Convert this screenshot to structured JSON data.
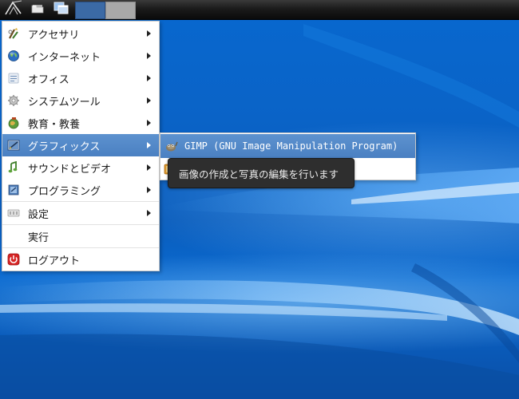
{
  "panel": {
    "icons": [
      "start-menu-icon",
      "file-manager-icon",
      "show-desktop-icon"
    ],
    "workspaces": [
      {
        "active": true,
        "color": "#3b6aa6"
      },
      {
        "active": false,
        "color": "#a9a9a9"
      }
    ]
  },
  "menu": {
    "items": [
      {
        "label": "アクセサリ",
        "icon": "accessories-icon",
        "submenu": true
      },
      {
        "label": "インターネット",
        "icon": "internet-globe-icon",
        "submenu": true
      },
      {
        "label": "オフィス",
        "icon": "office-icon",
        "submenu": true
      },
      {
        "label": "システムツール",
        "icon": "system-tools-icon",
        "submenu": true
      },
      {
        "label": "教育・教養",
        "icon": "education-icon",
        "submenu": true
      },
      {
        "label": "グラフィックス",
        "icon": "graphics-icon",
        "submenu": true,
        "active": true
      },
      {
        "label": "サウンドとビデオ",
        "icon": "sound-video-icon",
        "submenu": true
      },
      {
        "label": "プログラミング",
        "icon": "programming-icon",
        "submenu": true
      },
      {
        "label": "設定",
        "icon": "settings-icon",
        "submenu": true
      },
      {
        "label": "実行",
        "icon": "",
        "submenu": false
      },
      {
        "label": "ログアウト",
        "icon": "logout-icon",
        "submenu": false
      }
    ]
  },
  "submenu": {
    "items": [
      {
        "label": "GIMP (GNU Image Manipulation Program)",
        "icon": "gimp-icon",
        "active": true
      },
      {
        "label": "",
        "icon": "image-viewer-icon",
        "active": false
      }
    ]
  },
  "tooltip": {
    "text": "画像の作成と写真の編集を行います"
  },
  "colors": {
    "highlight": "#4a80c2",
    "desktop": "#0a5cbb",
    "tooltip_bg": "#2e2e2e"
  }
}
